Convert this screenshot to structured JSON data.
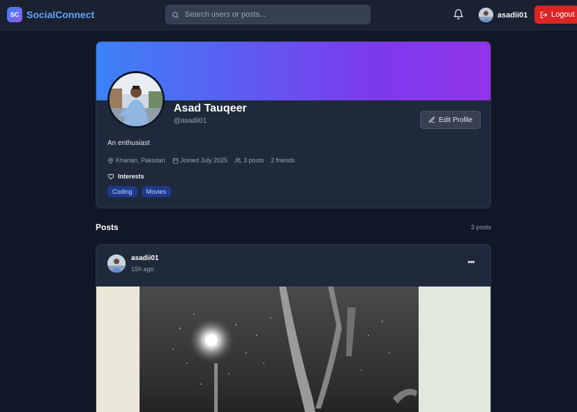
{
  "nav": {
    "brand_logo": "SC",
    "brand_name": "SocialConnect",
    "search_placeholder": "Search users or posts...",
    "username": "asadii01",
    "logout_label": "Logout"
  },
  "profile": {
    "name": "Asad Tauqeer",
    "handle": "@asadii01",
    "edit_label": "Edit Profile",
    "bio": "An enthusiast",
    "location": "Kharian, Pakistan",
    "joined": "Joined July 2025",
    "posts": "3 posts",
    "friends": "2 friends",
    "interests_label": "Interests",
    "interests": [
      "Coding",
      "Movies"
    ]
  },
  "posts_section": {
    "title": "Posts",
    "count": "3 posts"
  },
  "post": {
    "author": "asadii01",
    "time": "15h ago",
    "more": "•••"
  },
  "colors": {
    "accent": "#3b82f6",
    "cover_end": "#9333ea",
    "logout": "#dc2626",
    "tag_bg": "#1e3a8a"
  }
}
